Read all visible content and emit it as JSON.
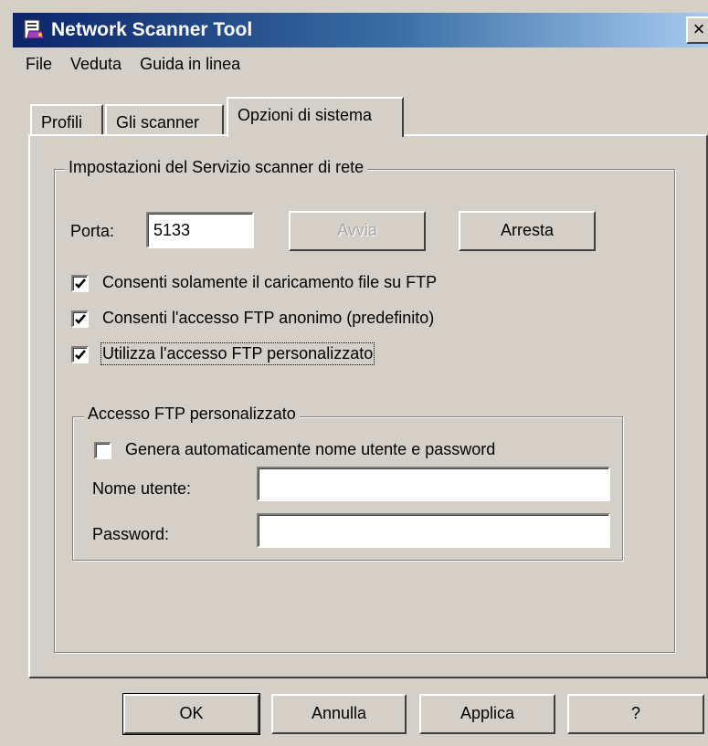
{
  "window": {
    "title": "Network Scanner Tool",
    "close_label": "×"
  },
  "menu": [
    "File",
    "Veduta",
    "Guida in linea"
  ],
  "tabs": [
    {
      "label": "Profili",
      "active": false
    },
    {
      "label": "Gli scanner",
      "active": false
    },
    {
      "label": "Opzioni di sistema",
      "active": true
    }
  ],
  "service_group": {
    "legend": "Impostazioni del Servizio scanner di rete",
    "port_label": "Porta:",
    "port_value": "5133",
    "start_button": "Avvia",
    "start_enabled": false,
    "stop_button": "Arresta",
    "checkboxes": [
      {
        "label": "Consenti solamente il caricamento file su FTP",
        "checked": true
      },
      {
        "label": "Consenti l'accesso FTP anonimo (predefinito)",
        "checked": true
      },
      {
        "label": "Utilizza l'accesso FTP personalizzato",
        "checked": true
      }
    ]
  },
  "ftp_group": {
    "legend": "Accesso FTP personalizzato",
    "auto_generate_label": "Genera automaticamente nome utente e password",
    "auto_generate_checked": false,
    "username_label": "Nome utente:",
    "username_value": "",
    "password_label": "Password:",
    "password_value": ""
  },
  "footer_buttons": {
    "ok": "OK",
    "cancel": "Annulla",
    "apply": "Applica",
    "help": "?"
  },
  "colors": {
    "face": "#d4d0c8",
    "title_start": "#0a246a",
    "title_end": "#a6caf0"
  }
}
